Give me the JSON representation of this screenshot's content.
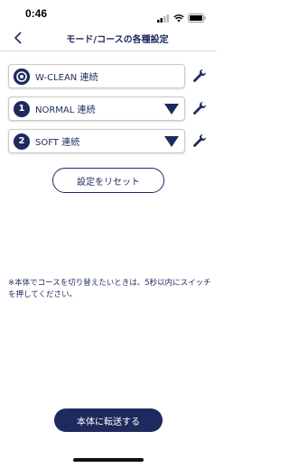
{
  "status_bar": {
    "time": "0:46"
  },
  "nav": {
    "title": "モード/コースの各種設定"
  },
  "rows": [
    {
      "icon": "target-icon",
      "label": "W-CLEAN 連続",
      "has_dropdown": false
    },
    {
      "icon": "1",
      "label": "NORMAL 連続",
      "has_dropdown": true
    },
    {
      "icon": "2",
      "label": "SOFT 連続",
      "has_dropdown": true
    }
  ],
  "reset_button": {
    "label": "設定をリセット"
  },
  "note": {
    "text": "※本体でコースを切り替えたいときは、5秒以内にスイッチを押してください。"
  },
  "transfer_button": {
    "label": "本体に転送する"
  },
  "colors": {
    "primary": "#1e2a5e",
    "background": "#ffffff"
  }
}
